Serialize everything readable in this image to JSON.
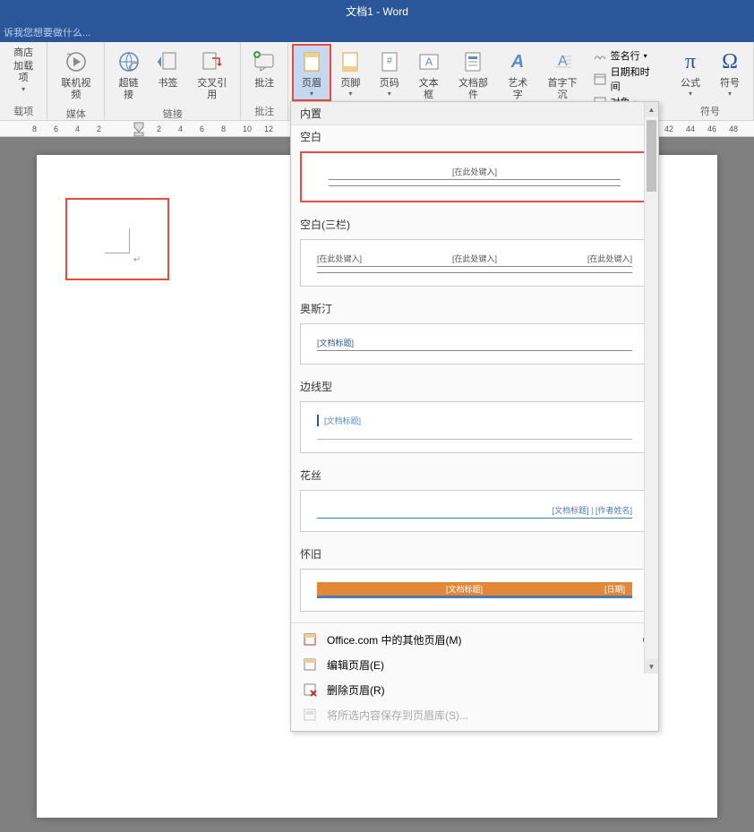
{
  "title": "文档1 - Word",
  "tell_me": "诉我您想要做什么...",
  "ribbon": {
    "store": "商店",
    "addins": "加载项",
    "addins_group": "载项",
    "online_video": "联机视频",
    "media_group": "媒体",
    "hyperlink": "超链接",
    "bookmark": "书签",
    "cross_reference": "交叉引用",
    "links_group": "链接",
    "comment": "批注",
    "comments_group": "批注",
    "header": "页眉",
    "footer": "页脚",
    "page_number": "页码",
    "text_box": "文本框",
    "document_parts": "文档部件",
    "word_art": "艺术字",
    "drop_cap": "首字下沉",
    "signature_line": "签名行",
    "date_time": "日期和时间",
    "object": "对象",
    "equation": "公式",
    "symbol": "符号",
    "symbols_group": "符号"
  },
  "ruler": {
    "marks": [
      "8",
      "6",
      "4",
      "2",
      "",
      "2",
      "4",
      "6",
      "8",
      "10",
      "12",
      "42",
      "44",
      "46",
      "48"
    ]
  },
  "dropdown": {
    "builtin": "内置",
    "blank": "空白",
    "blank_placeholder": "[在此处键入]",
    "blank_3col": "空白(三栏)",
    "austin": "奥斯汀",
    "austin_placeholder": "[文档标题]",
    "border": "边线型",
    "border_placeholder": "[文档标题]",
    "filigree": "花丝",
    "filigree_placeholder": "[文档标题] | [作者姓名]",
    "nostalgia": "怀旧",
    "nostalgia_title": "[文档标题]",
    "nostalgia_date": "[日期]",
    "more_from_office": "Office.com 中的其他页眉(M)",
    "edit_header": "编辑页眉(E)",
    "remove_header": "删除页眉(R)",
    "save_to_gallery": "将所选内容保存到页眉库(S)..."
  }
}
